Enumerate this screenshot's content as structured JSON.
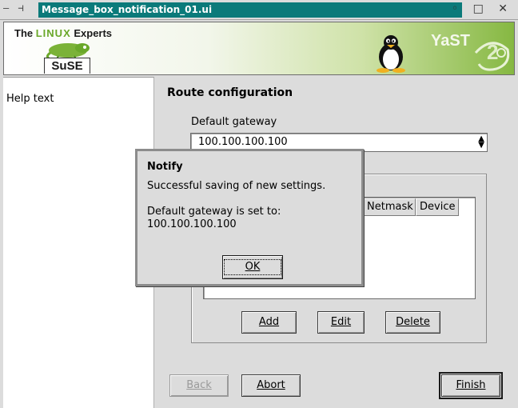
{
  "window": {
    "left_controls": "— ⊣",
    "title": "Message_box_notification_01.ui",
    "controls": "◦ □ ✕"
  },
  "banner": {
    "brand_prefix": "The ",
    "brand_linux": "LINUX",
    "brand_suffix": " Experts",
    "suse": "SuSE",
    "yast": "YaST"
  },
  "help": {
    "text": "Help text"
  },
  "main": {
    "title": "Route configuration",
    "gateway_label": "Default gateway",
    "gateway_value": "100.100.100.100",
    "columns_visible": [
      "Netmask",
      "Device"
    ],
    "buttons": {
      "add": "Add",
      "edit": "Edit",
      "delete": "Delete"
    }
  },
  "footer": {
    "back": "Back",
    "abort": "Abort",
    "finish": "Finish"
  },
  "dialog": {
    "title": "Notify",
    "message": "Successful saving of new settings.",
    "detail_line1": "Default gateway is set to:",
    "detail_line2": "100.100.100.100",
    "ok": "OK"
  },
  "colors": {
    "titlebar": "#0b7a7a",
    "banner_green": "#86b842",
    "linux_green": "#6aa82a"
  }
}
